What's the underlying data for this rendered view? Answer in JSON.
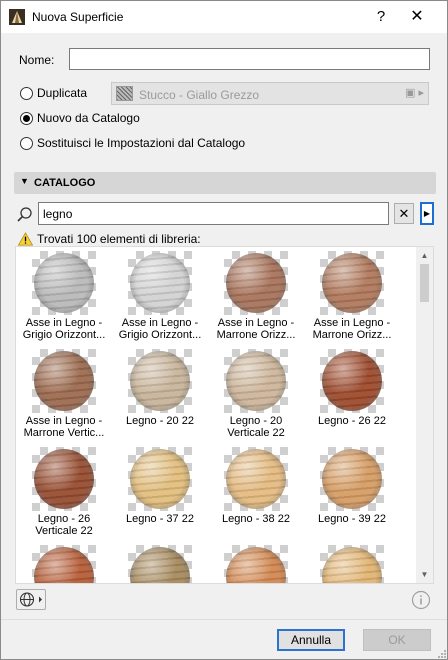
{
  "window": {
    "title": "Nuova Superficie",
    "help_label": "?",
    "close_label": "✕"
  },
  "form": {
    "name_label": "Nome:",
    "name_value": "",
    "radio_options": [
      {
        "label": "Duplicata",
        "checked": false
      },
      {
        "label": "Nuovo da Catalogo",
        "checked": true
      },
      {
        "label": "Sostituisci le Impostazioni dal Catalogo",
        "checked": false
      }
    ],
    "duplicate_source": "Stucco - Giallo Grezzo"
  },
  "catalog": {
    "header": "CATALOGO",
    "search_value": "legno",
    "clear_label": "✕",
    "results_text": "Trovati 100 elementi di libreria:",
    "items": [
      {
        "label1": "Asse in Legno -",
        "label2": "Grigio Orizzont...",
        "color": "#b9b9b9"
      },
      {
        "label1": "Asse in Legno -",
        "label2": "Grigio Orizzont...",
        "color": "#d2d2d2"
      },
      {
        "label1": "Asse in Legno -",
        "label2": "Marrone Orizz...",
        "color": "#a8735a"
      },
      {
        "label1": "Asse in Legno -",
        "label2": "Marrone Orizz...",
        "color": "#b0785b"
      },
      {
        "label1": "Asse in Legno -",
        "label2": "Marrone Vertic...",
        "color": "#9c6a4e"
      },
      {
        "label1": "Legno - 20 22",
        "label2": "",
        "color": "#c8b49a"
      },
      {
        "label1": "Legno - 20",
        "label2": "Verticale 22",
        "color": "#cdb59a"
      },
      {
        "label1": "Legno - 26 22",
        "label2": "",
        "color": "#9d4a2c"
      },
      {
        "label1": "Legno - 26",
        "label2": "Verticale 22",
        "color": "#964c30"
      },
      {
        "label1": "Legno - 37 22",
        "label2": "",
        "color": "#e2bd7c"
      },
      {
        "label1": "Legno - 38 22",
        "label2": "",
        "color": "#e4ba80"
      },
      {
        "label1": "Legno - 39 22",
        "label2": "",
        "color": "#d69c63"
      },
      {
        "label1": "",
        "label2": "",
        "color": "#b65c36"
      },
      {
        "label1": "",
        "label2": "",
        "color": "#a78a5e"
      },
      {
        "label1": "",
        "label2": "",
        "color": "#d2874f"
      },
      {
        "label1": "",
        "label2": "",
        "color": "#e2b472"
      }
    ]
  },
  "footer": {
    "cancel_label": "Annulla",
    "ok_label": "OK"
  },
  "colors": {
    "accent": "#1b6fd1",
    "section_bg": "#d6d6d6"
  }
}
